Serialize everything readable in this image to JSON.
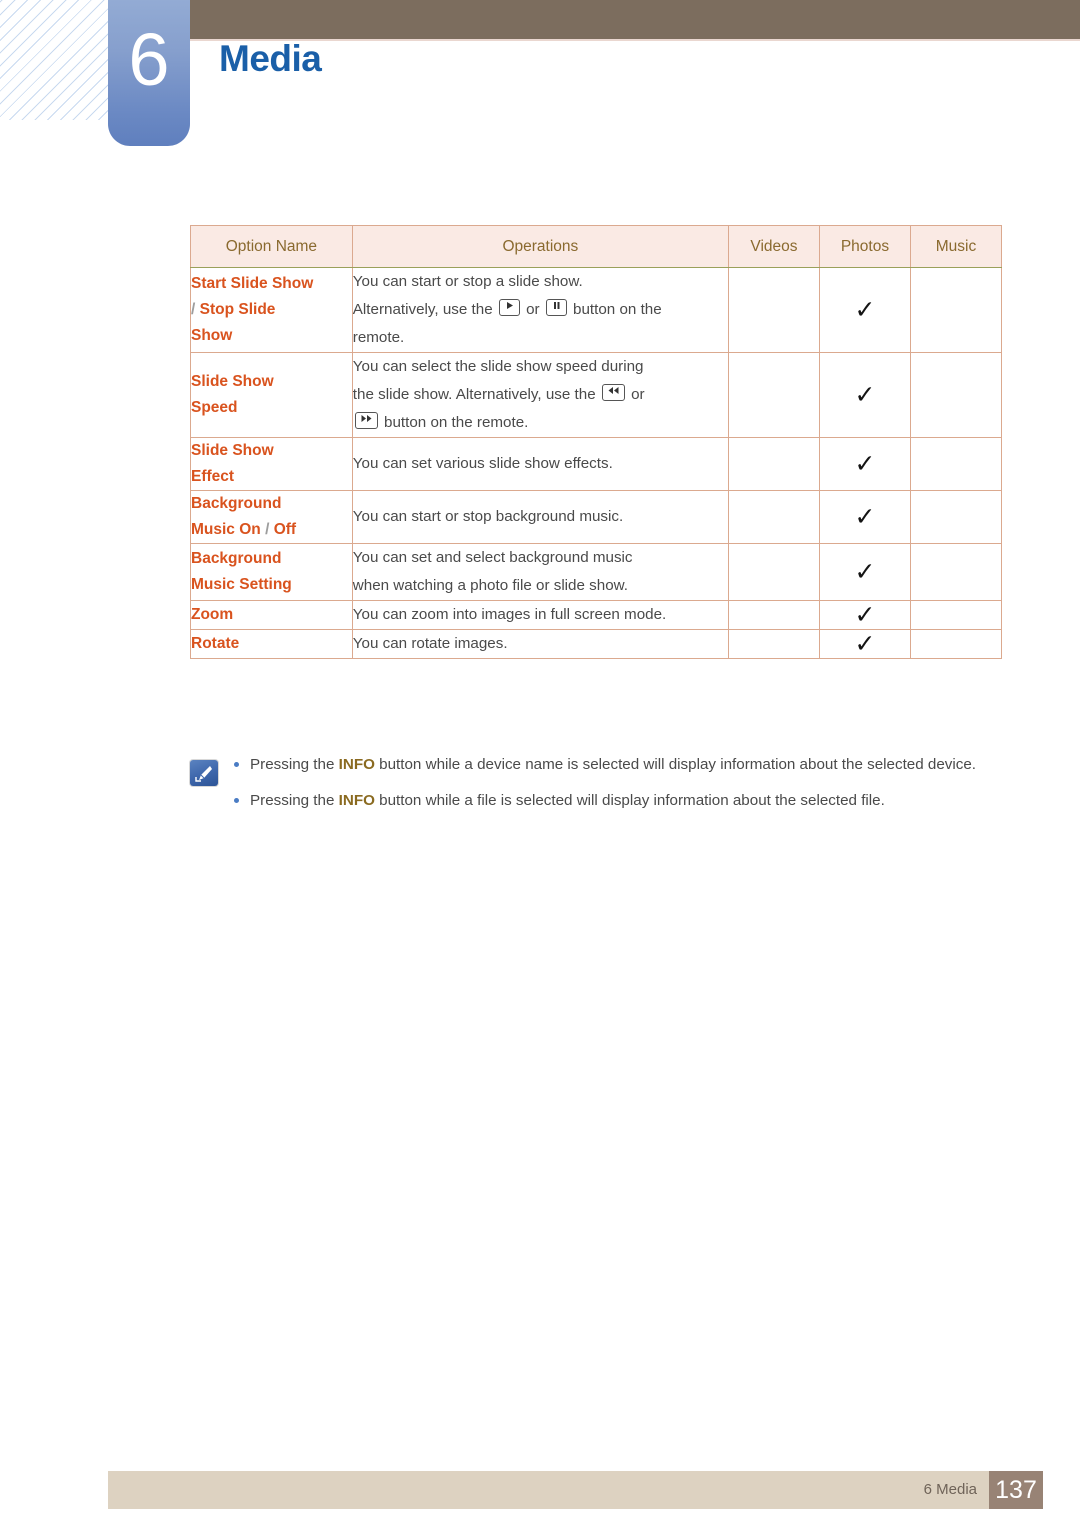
{
  "chapter": {
    "number": "6",
    "title": "Media"
  },
  "table": {
    "headers": [
      "Option Name",
      "Operations",
      "Videos",
      "Photos",
      "Music"
    ],
    "rows": [
      {
        "option_lines": [
          "Start Slide Show",
          "/ Stop Slide",
          "Show"
        ],
        "operation_lines": [
          "You can start or stop a slide show.",
          "Alternatively, use the [play] or [pause] button on the",
          "remote."
        ],
        "videos": "",
        "photos": "✓",
        "music": ""
      },
      {
        "option_lines": [
          "Slide Show",
          "Speed"
        ],
        "operation_lines": [
          "You can select the slide show speed during",
          "the slide show. Alternatively, use the [rewind] or",
          "[forward] button on the remote."
        ],
        "videos": "",
        "photos": "✓",
        "music": ""
      },
      {
        "option_lines": [
          "Slide Show",
          "Effect"
        ],
        "operation_lines": [
          "You can set various slide show effects."
        ],
        "videos": "",
        "photos": "✓",
        "music": ""
      },
      {
        "option_lines": [
          "Background",
          "Music On / Off"
        ],
        "operation_lines": [
          "You can start or stop background music."
        ],
        "videos": "",
        "photos": "✓",
        "music": ""
      },
      {
        "option_lines": [
          "Background",
          "Music Setting"
        ],
        "operation_lines": [
          "You can set and select background music",
          "when watching a photo file or slide show."
        ],
        "videos": "",
        "photos": "✓",
        "music": ""
      },
      {
        "option_lines": [
          "Zoom"
        ],
        "operation_lines": [
          "You can zoom into images in full screen mode."
        ],
        "videos": "",
        "photos": "✓",
        "music": ""
      },
      {
        "option_lines": [
          "Rotate"
        ],
        "operation_lines": [
          "You can rotate images."
        ],
        "videos": "",
        "photos": "✓",
        "music": ""
      }
    ]
  },
  "notes": {
    "icon_name": "note-pen-icon",
    "items": [
      {
        "prefix": "Pressing the ",
        "keyword": "INFO",
        "suffix": " button while a device name is selected will display information about the selected device."
      },
      {
        "prefix": "Pressing the ",
        "keyword": "INFO",
        "suffix": " button while a file is selected will display information about the selected file."
      }
    ]
  },
  "footer": {
    "label": "6 Media",
    "page": "137"
  },
  "colors": {
    "accent_orange": "#d9531e",
    "header_gold": "#8a6a2f",
    "chapter_blue": "#1a5fa8",
    "brown_bar": "#7c6d5e",
    "footer_bg": "#ddd2c1",
    "footer_page_bg": "#988375",
    "table_border": "#dba98f",
    "table_header_bg": "#faeae4",
    "info_keyword": "#8a6a20"
  }
}
